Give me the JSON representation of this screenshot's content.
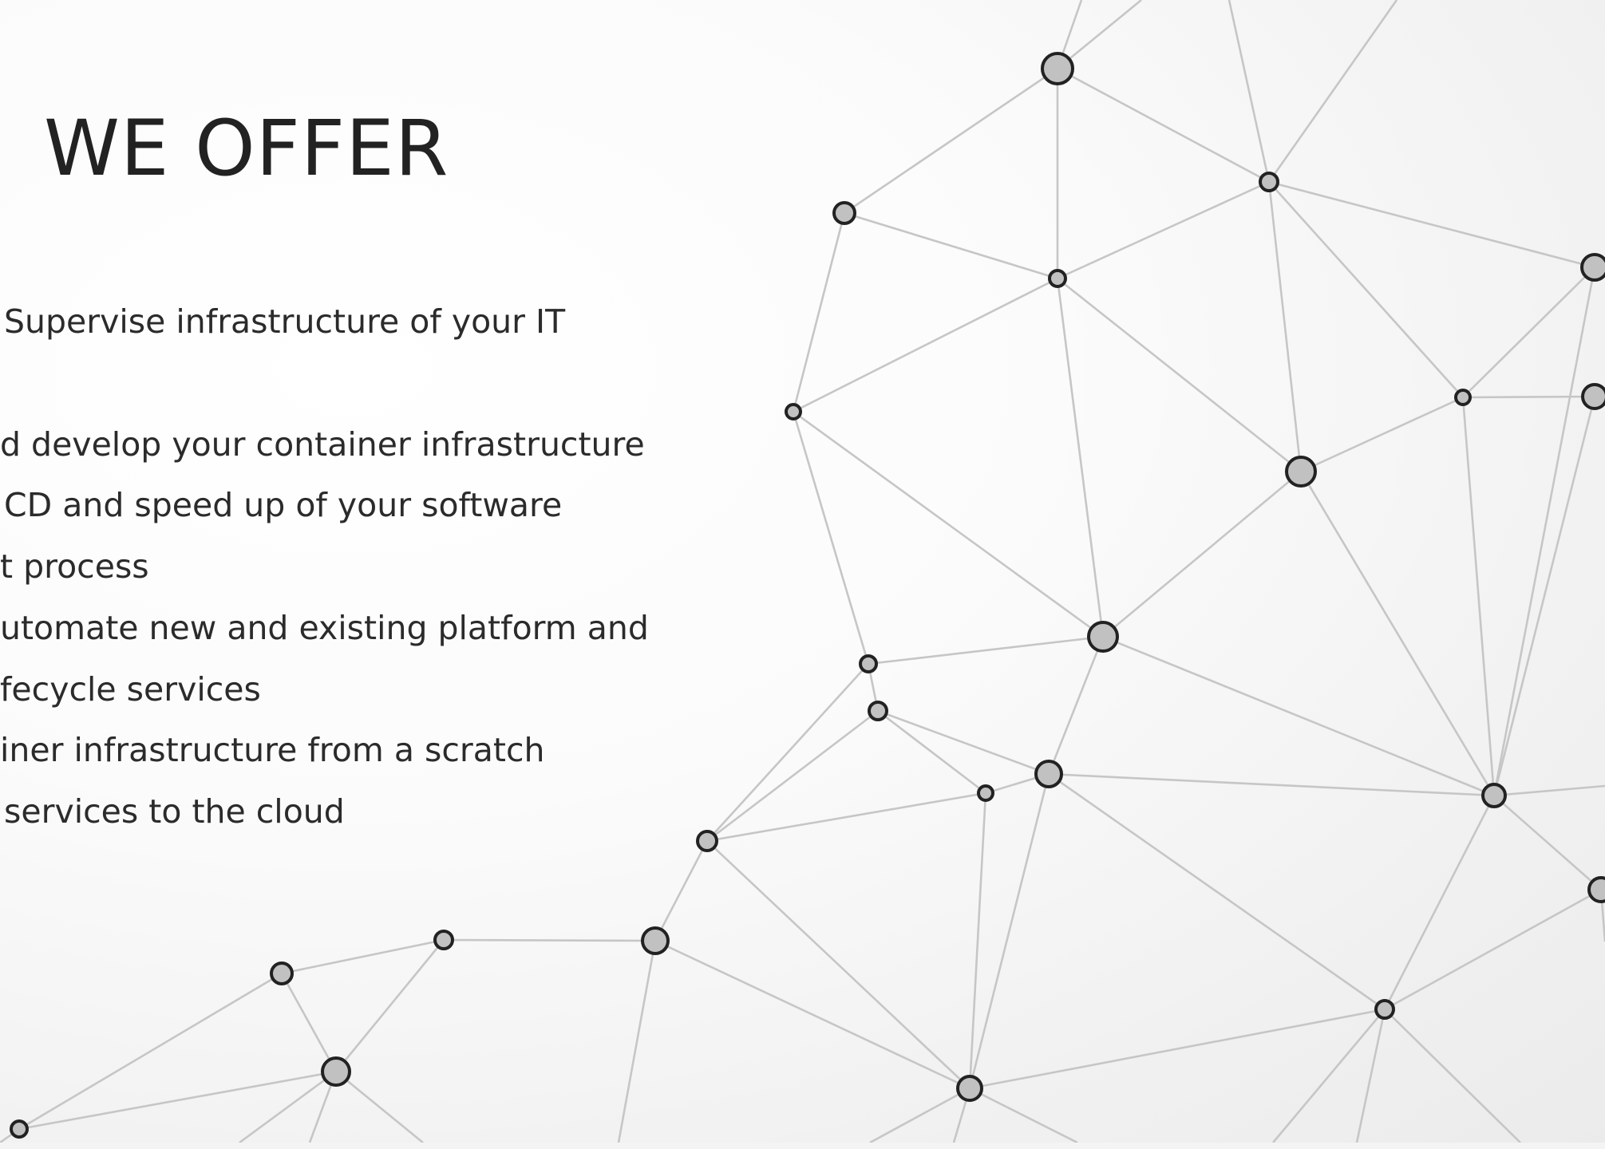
{
  "slide": {
    "title": "WE OFFER",
    "offer_lines": [
      "Supervise infrastructure of your IT",
      "d develop your container infrastructure",
      "CD and speed up of your software",
      "t process",
      "utomate new and existing platform and",
      "fecycle services",
      "iner infrastructure from a scratch",
      "services to the cloud"
    ]
  },
  "decoration": {
    "name": "network-graph",
    "node_fill": "#c1c1c1",
    "node_stroke": "#222222",
    "edge_color": "#c6c6c6"
  }
}
